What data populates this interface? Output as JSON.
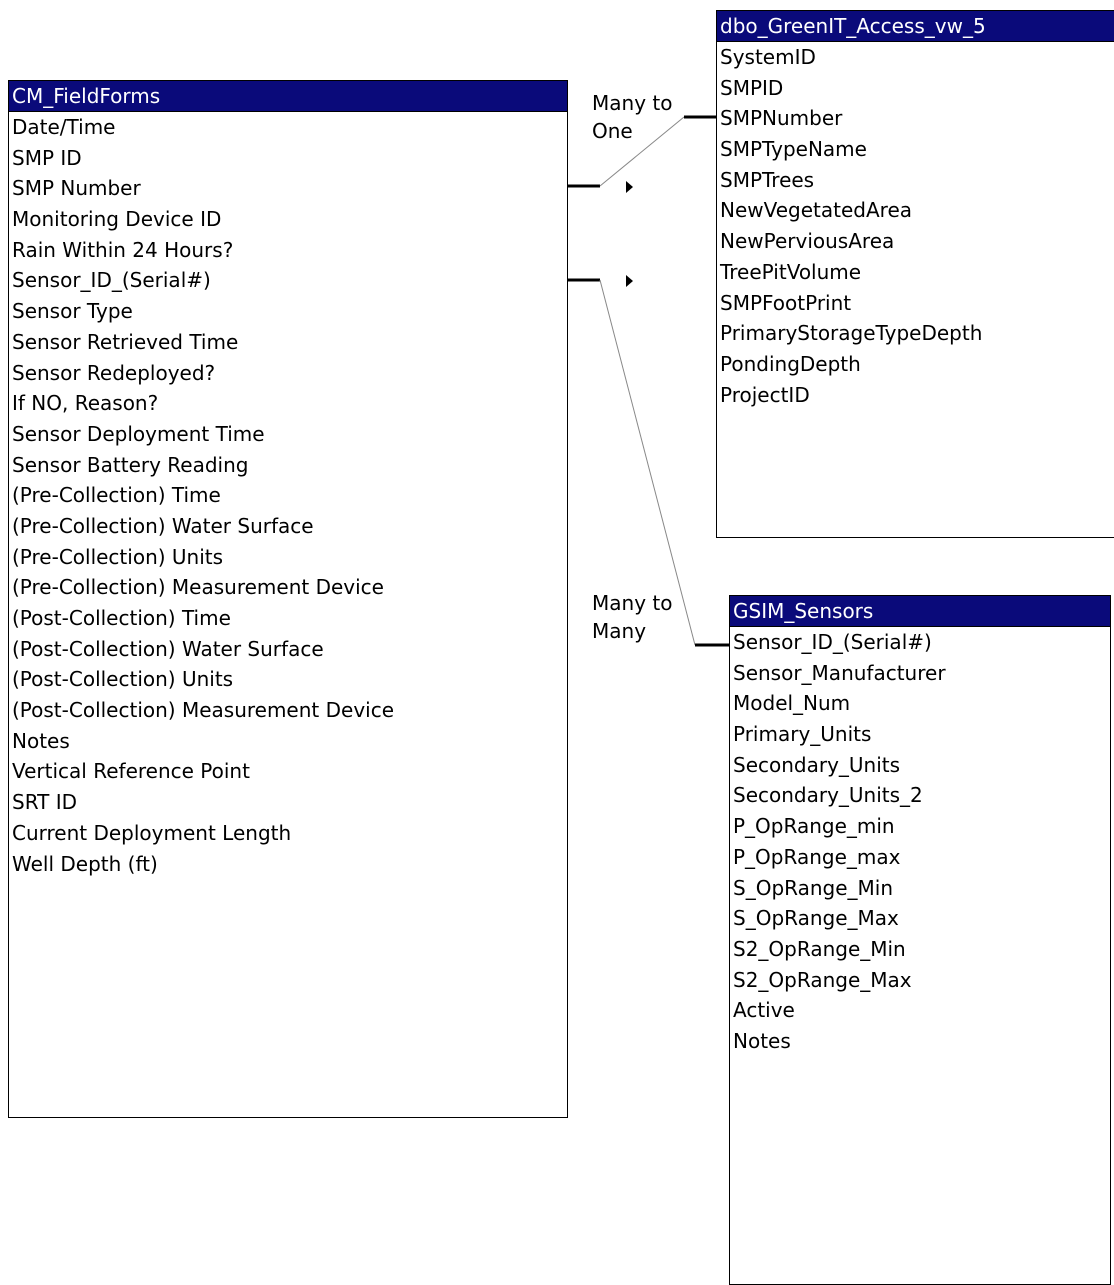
{
  "tables": {
    "cm_fieldforms": {
      "title": "CM_FieldForms",
      "header_color": "#0a0a7a",
      "fields": [
        "Date/Time",
        "SMP ID",
        "SMP Number",
        "Monitoring Device ID",
        "Rain Within 24 Hours?",
        "Sensor_ID_(Serial#)",
        "Sensor Type",
        "Sensor Retrieved Time",
        "Sensor Redeployed?",
        "If NO, Reason?",
        "Sensor Deployment Time",
        "Sensor Battery Reading",
        "(Pre-Collection) Time",
        "(Pre-Collection) Water Surface",
        "(Pre-Collection) Units",
        "(Pre-Collection) Measurement Device",
        "(Post-Collection) Time",
        "(Post-Collection) Water Surface",
        "(Post-Collection) Units",
        "(Post-Collection) Measurement Device",
        "Notes",
        "Vertical Reference Point",
        "SRT ID",
        "Current Deployment Length",
        "Well Depth (ft)"
      ]
    },
    "dbo_greenit": {
      "title": "dbo_GreenIT_Access_vw_5",
      "header_color": "#0a0a7a",
      "fields": [
        "SystemID",
        "SMPID",
        "SMPNumber",
        "SMPTypeName",
        "SMPTrees",
        "NewVegetatedArea",
        "NewPerviousArea",
        "TreePitVolume",
        "SMPFootPrint",
        "PrimaryStorageTypeDepth",
        "PondingDepth",
        "ProjectID"
      ]
    },
    "gsim_sensors": {
      "title": "GSIM_Sensors",
      "header_color": "#0a0a7a",
      "fields": [
        "Sensor_ID_(Serial#)",
        "Sensor_Manufacturer",
        "Model_Num",
        "Primary_Units",
        "Secondary_Units",
        "Secondary_Units_2",
        "P_OpRange_min",
        "P_OpRange_max",
        "S_OpRange_Min",
        "S_OpRange_Max",
        "S2_OpRange_Min",
        "S2_OpRange_Max",
        "Active",
        "Notes"
      ]
    }
  },
  "relationships": [
    {
      "label_line1": "Many to",
      "label_line2": "One",
      "from": "CM_FieldForms.SMP Number",
      "to": "dbo_GreenIT_Access_vw_5.SMPNumber"
    },
    {
      "label_line1": "Many to",
      "label_line2": "Many",
      "from": "CM_FieldForms.Sensor_ID_(Serial#)",
      "to": "GSIM_Sensors.Sensor_ID_(Serial#)"
    }
  ]
}
